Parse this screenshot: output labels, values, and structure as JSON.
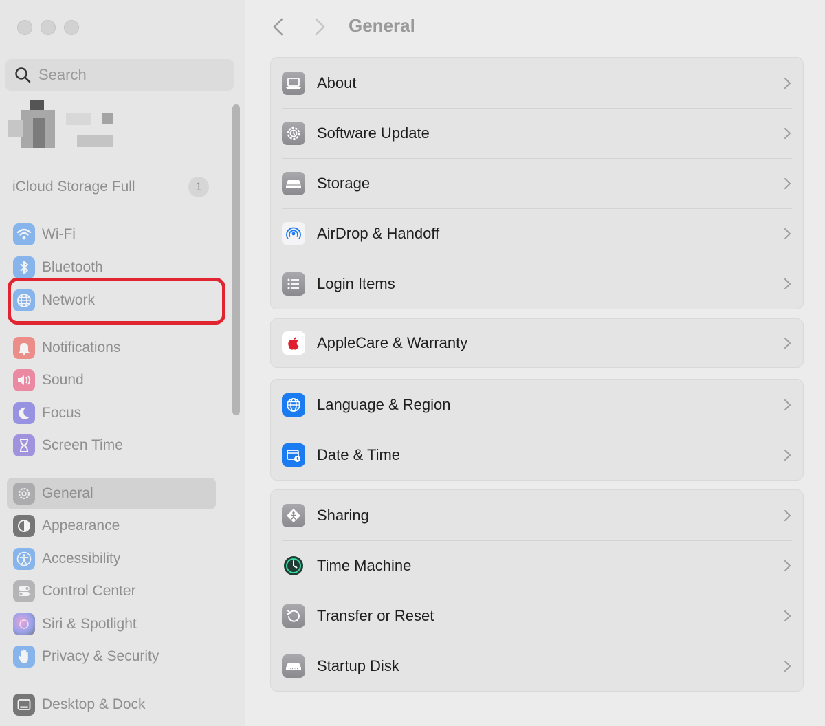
{
  "sidebar": {
    "search_placeholder": "Search",
    "icloud": {
      "label": "iCloud Storage Full",
      "badge": "1"
    },
    "items": [
      {
        "label": "Wi-Fi",
        "icon": "wifi-icon",
        "color": "#3a8cf0"
      },
      {
        "label": "Bluetooth",
        "icon": "bluetooth-icon",
        "color": "#3a8cf0"
      },
      {
        "label": "Network",
        "icon": "globe-icon",
        "color": "#3a8cf0"
      },
      {
        "label": "Notifications",
        "icon": "bell-icon",
        "color": "#f0483e"
      },
      {
        "label": "Sound",
        "icon": "speaker-icon",
        "color": "#f03e6e"
      },
      {
        "label": "Focus",
        "icon": "moon-icon",
        "color": "#5a4ee0"
      },
      {
        "label": "Screen Time",
        "icon": "hourglass-icon",
        "color": "#6a4ed8"
      },
      {
        "label": "General",
        "icon": "gear-icon",
        "color": "#8e8e93"
      },
      {
        "label": "Appearance",
        "icon": "appearance-icon",
        "color": "#1c1c1e"
      },
      {
        "label": "Accessibility",
        "icon": "accessibility-icon",
        "color": "#3a8cf0"
      },
      {
        "label": "Control Center",
        "icon": "toggles-icon",
        "color": "#8e8e93"
      },
      {
        "label": "Siri & Spotlight",
        "icon": "siri-icon",
        "color": "#a040e0"
      },
      {
        "label": "Privacy & Security",
        "icon": "hand-icon",
        "color": "#3a8cf0"
      },
      {
        "label": "Desktop & Dock",
        "icon": "dock-icon",
        "color": "#1c1c1e"
      }
    ],
    "selected": "General",
    "highlight_color": "#e02531"
  },
  "main": {
    "title": "General",
    "groups": [
      [
        {
          "label": "About",
          "icon": "laptop-icon"
        },
        {
          "label": "Software Update",
          "icon": "gear-badge-icon"
        },
        {
          "label": "Storage",
          "icon": "drive-icon"
        },
        {
          "label": "AirDrop & Handoff",
          "icon": "airdrop-icon"
        },
        {
          "label": "Login Items",
          "icon": "list-icon"
        }
      ],
      [
        {
          "label": "AppleCare & Warranty",
          "icon": "apple-logo-icon"
        }
      ],
      [
        {
          "label": "Language & Region",
          "icon": "globe-icon"
        },
        {
          "label": "Date & Time",
          "icon": "calendar-clock-icon"
        }
      ],
      [
        {
          "label": "Sharing",
          "icon": "sharing-icon"
        },
        {
          "label": "Time Machine",
          "icon": "time-machine-icon"
        },
        {
          "label": "Transfer or Reset",
          "icon": "reset-icon"
        },
        {
          "label": "Startup Disk",
          "icon": "disk-icon"
        }
      ]
    ]
  }
}
